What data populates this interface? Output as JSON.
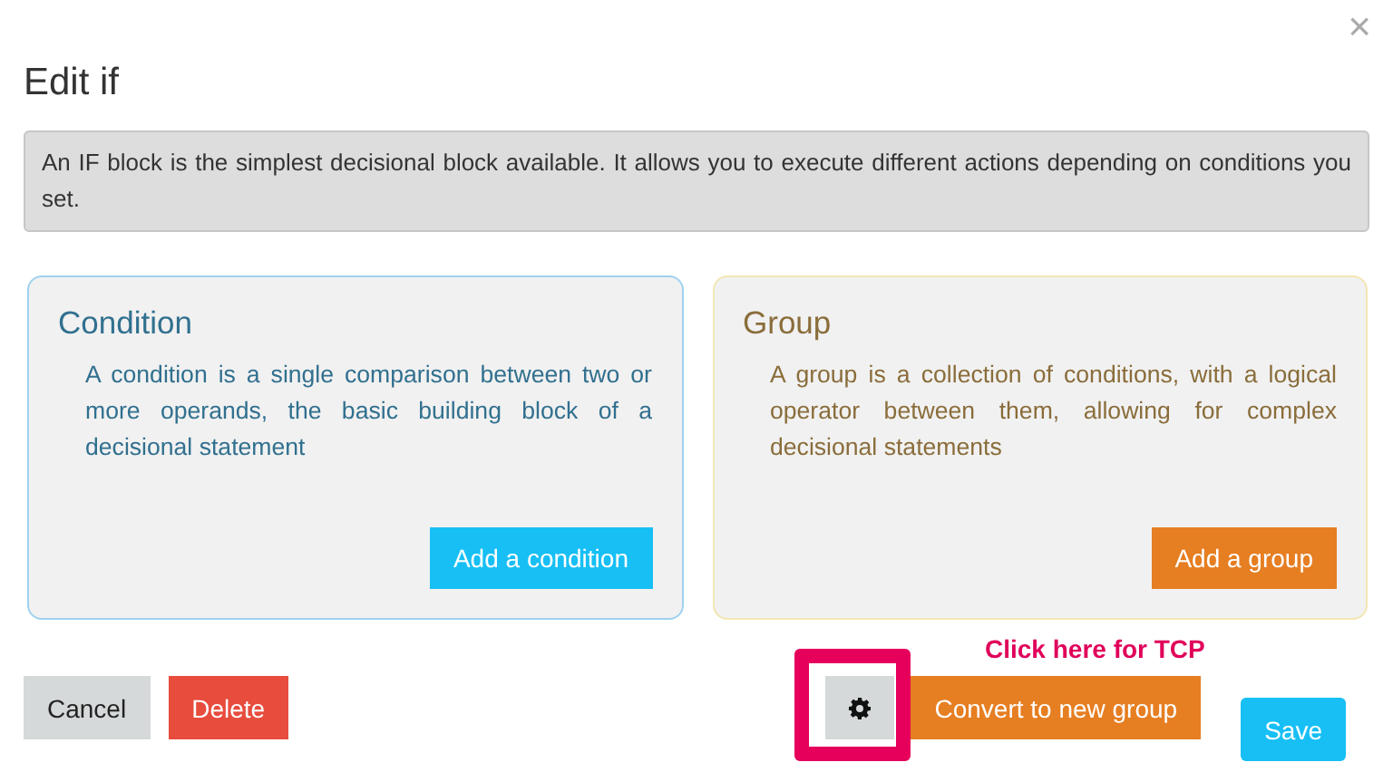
{
  "dialog": {
    "title": "Edit if",
    "close": "×",
    "info": "An IF block is the simplest decisional block available. It allows you to execute different actions depending on conditions you set."
  },
  "panels": [
    {
      "kind": "condition",
      "title": "Condition",
      "text": "A condition is a single comparison between two or more operands, the basic building block of a decisional statement",
      "button": "Add a condition"
    },
    {
      "kind": "group",
      "title": "Group",
      "text": "A group is a collection of conditions, with a logical operator between them, allowing for complex decisional statements",
      "button": "Add a group"
    }
  ],
  "footer_left": [
    {
      "kind": "default",
      "label": "Cancel"
    },
    {
      "kind": "danger",
      "label": "Delete"
    }
  ],
  "footer_right": [
    {
      "kind": "settings"
    },
    {
      "kind": "warning",
      "label": "Convert to new group"
    },
    {
      "kind": "info",
      "label": "Save"
    }
  ],
  "annotation": {
    "text": "Click here for TCP"
  }
}
